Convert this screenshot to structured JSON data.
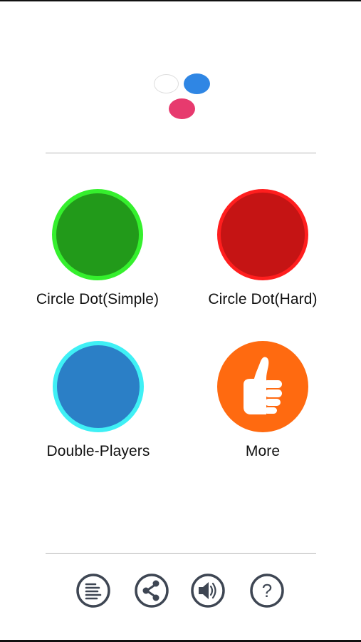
{
  "colors": {
    "logo_white_dot": "#ffffff",
    "logo_blue_dot": "#2f86e4",
    "logo_pink_dot": "#e73a6e",
    "simple_fill": "#229a1a",
    "simple_ring": "#35f02d",
    "hard_fill": "#c51414",
    "hard_ring": "#ff1e1e",
    "double_fill": "#2b7fc6",
    "double_ring": "#3ff0f5",
    "more_fill": "#ff6a10",
    "toolbar_icon": "#3e4653",
    "divider": "#b5b5b5"
  },
  "modes": {
    "simple_label": "Circle Dot(Simple)",
    "hard_label": "Circle Dot(Hard)",
    "double_label": "Double-Players",
    "more_label": "More",
    "more_icon": "thumbs-up-icon"
  },
  "toolbar": {
    "icons": [
      "list-icon",
      "share-icon",
      "sound-icon",
      "help-icon"
    ],
    "help_glyph": "?"
  }
}
